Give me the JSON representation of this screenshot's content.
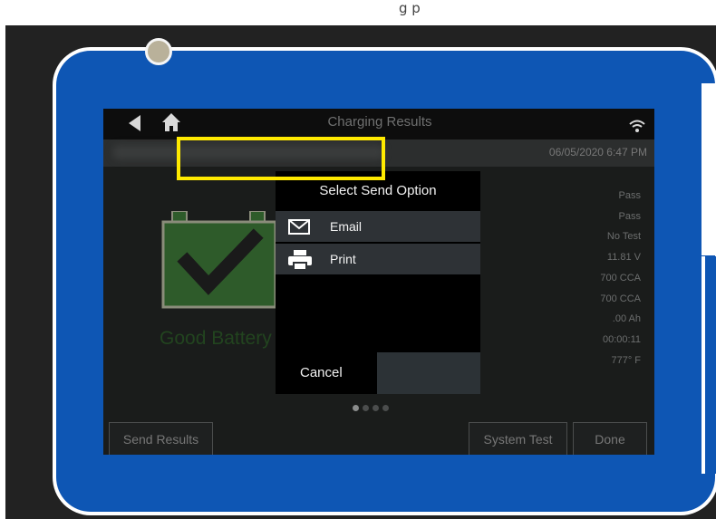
{
  "caption": {
    "text": "g         p"
  },
  "screen": {
    "title": "Charging Results",
    "datetime": "06/05/2020 6:47 PM",
    "battery_status": "Good Battery",
    "results": [
      "Pass",
      "Pass",
      "No Test",
      "11.81 V",
      "700 CCA",
      "700 CCA",
      ".00 Ah",
      "00:00:11",
      "777° F"
    ],
    "page_indicator": {
      "count": 4,
      "current": 1
    }
  },
  "dialog": {
    "title": "Select Send Option",
    "options": [
      {
        "label": "Email",
        "icon": "email-icon"
      },
      {
        "label": "Print",
        "icon": "printer-icon"
      }
    ],
    "cancel_label": "Cancel"
  },
  "buttons": {
    "send_results": "Send Results",
    "system_test": "System Test",
    "done": "Done"
  },
  "colors": {
    "device_blue": "#0e56b4",
    "highlight": "#ffea00",
    "battery_green": "#2e5b2a"
  },
  "icons": [
    "back-arrow-icon",
    "home-icon",
    "wifi-icon",
    "battery-check-icon",
    "email-icon",
    "printer-icon"
  ]
}
